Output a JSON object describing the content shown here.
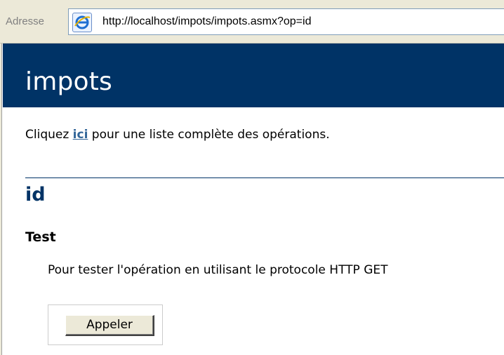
{
  "browser": {
    "address_label": "Adresse",
    "url": "http://localhost/impots/impots.asmx?op=id",
    "icon": "ie-page-icon"
  },
  "page": {
    "title": "impots",
    "intro_before": "Cliquez ",
    "intro_link": "ici",
    "intro_after": " pour une liste complète des opérations.",
    "operation_title": "id",
    "section_title": "Test",
    "section_desc": "Pour tester l'opération en utilisant le protocole HTTP GET",
    "invoke_label": "Appeler"
  },
  "colors": {
    "header_bg": "#003366",
    "link": "#336699",
    "operation_title": "#003366"
  }
}
